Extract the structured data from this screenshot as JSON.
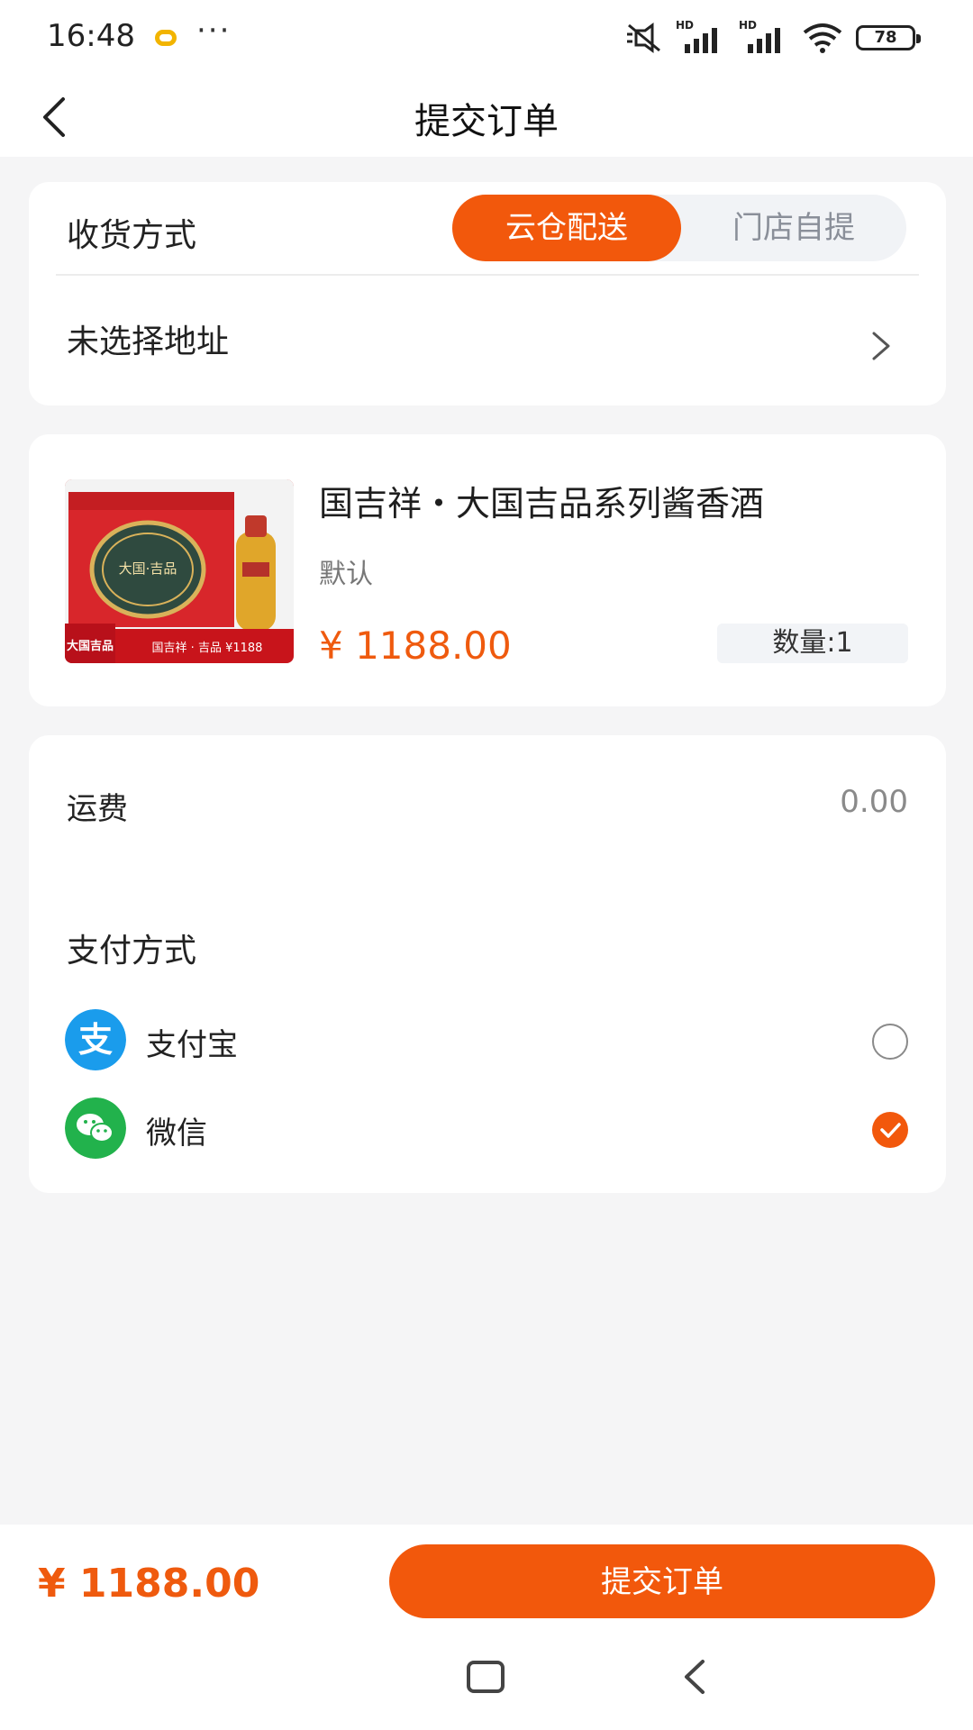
{
  "status_bar": {
    "time": "16:48",
    "more": "···",
    "signal_label": "HD",
    "battery": "78"
  },
  "nav": {
    "title": "提交订单"
  },
  "delivery": {
    "label": "收货方式",
    "options": [
      "云仓配送",
      "门店自提"
    ],
    "selected": "云仓配送",
    "address_placeholder": "未选择地址"
  },
  "product": {
    "title": "国吉祥・大国吉品系列酱香酒",
    "spec": "默认",
    "price": "¥ 1188.00",
    "quantity": "数量:1",
    "image_text": {
      "box_label": "大国·吉品",
      "corner_tag": "大国吉品",
      "caption": "国吉祥 · 吉品  ¥1188"
    }
  },
  "fees": {
    "shipping_label": "运费",
    "shipping_value": "0.00"
  },
  "payment": {
    "heading": "支付方式",
    "methods": [
      {
        "label": "支付宝",
        "selected": false,
        "color": "#1a9cec"
      },
      {
        "label": "微信",
        "selected": true,
        "color": "#22b24c"
      }
    ]
  },
  "footer": {
    "total": "¥ 1188.00",
    "submit_label": "提交订单"
  },
  "colors": {
    "accent": "#f2580c",
    "price": "#ef5a0e",
    "background": "#f5f5f6"
  }
}
